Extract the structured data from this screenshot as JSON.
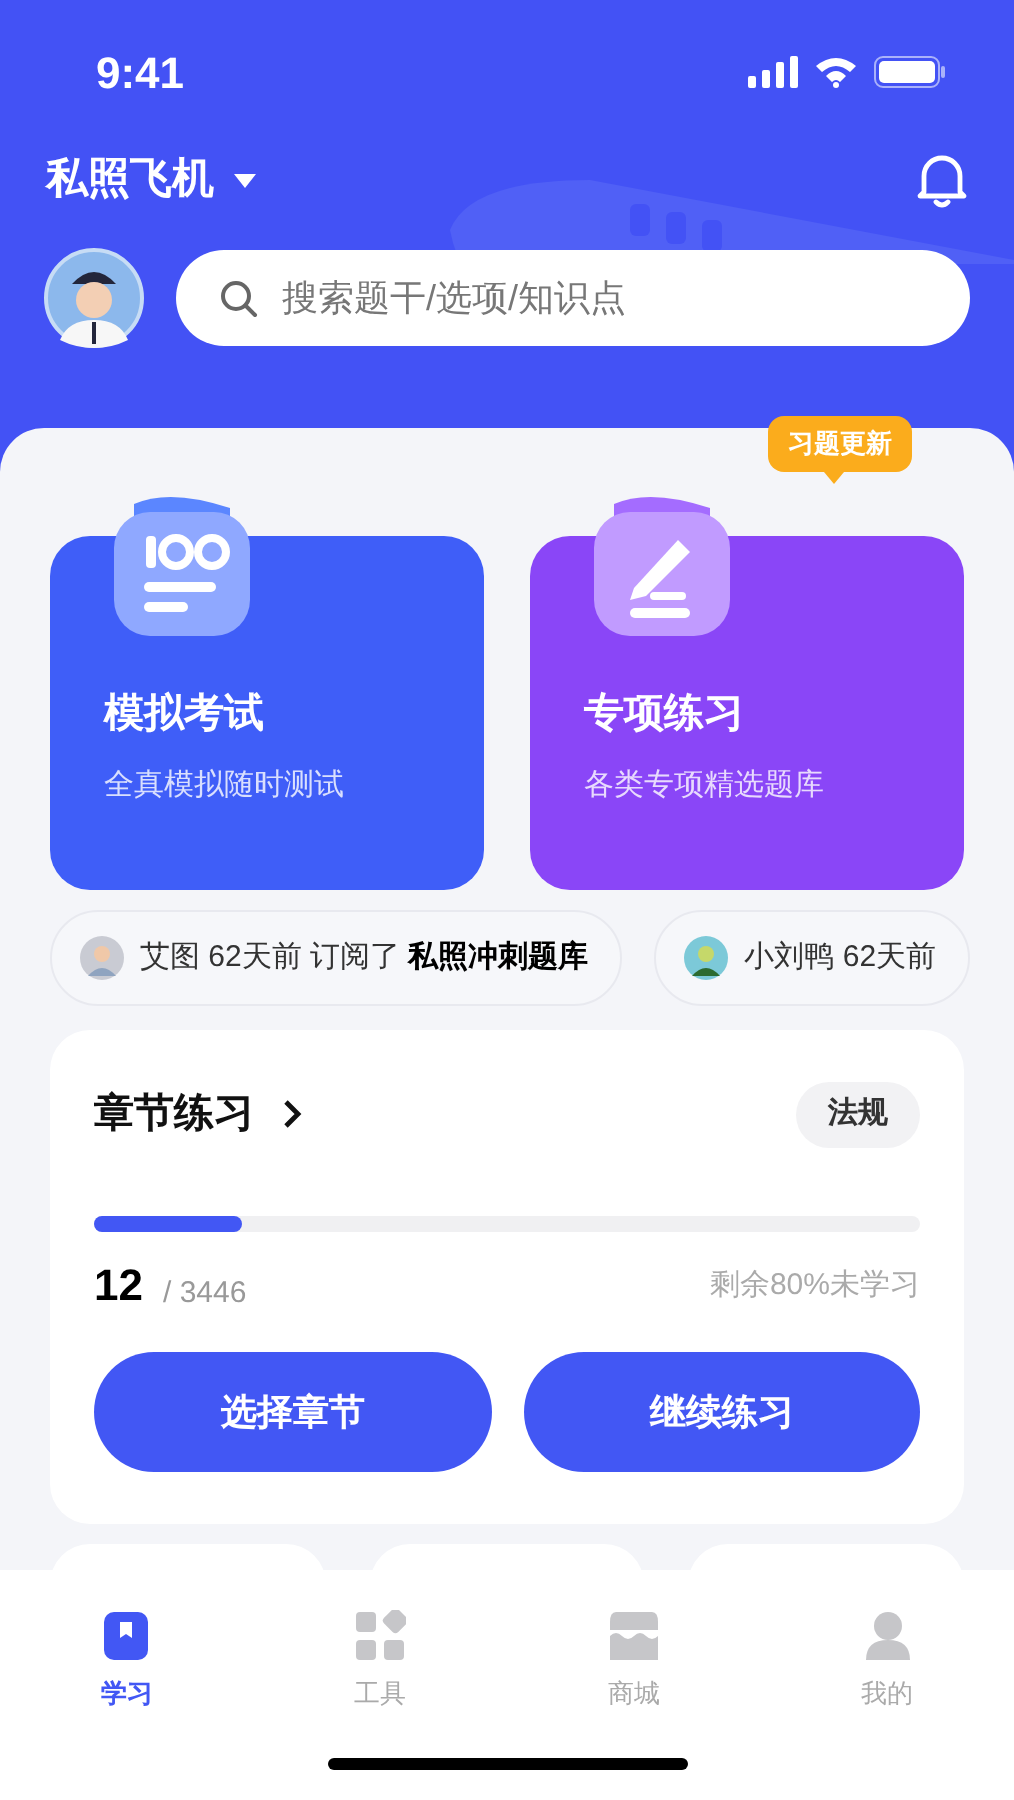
{
  "status_bar": {
    "time": "9:41"
  },
  "header": {
    "subject": "私照飞机"
  },
  "search": {
    "placeholder": "搜索题干/选项/知识点"
  },
  "feature_cards": [
    {
      "kind": "exam",
      "title": "模拟考试",
      "subtitle": "全真模拟随时测试",
      "color": "#3f5ef8"
    },
    {
      "kind": "practice",
      "title": "专项练习",
      "subtitle": "各类专项精选题库",
      "color": "#8a46f7",
      "badge": "习题更新"
    }
  ],
  "ticker": [
    {
      "text": "艾图 62天前 订阅了 **私照冲刺题库**"
    },
    {
      "text": "小刘鸭 62天前"
    }
  ],
  "chapter": {
    "title": "章节练习",
    "tag": "法规",
    "level": 0.18,
    "done": "12",
    "total": "/ 3446",
    "remaining": "剩余80%未学习",
    "buttons": [
      "选择章节",
      "继续练习"
    ]
  },
  "tab_bar": [
    {
      "kind": "study",
      "label": "学习",
      "selected": true
    },
    {
      "kind": "tools",
      "label": "工具",
      "selected": false
    },
    {
      "kind": "shop",
      "label": "商城",
      "selected": false
    },
    {
      "kind": "me",
      "label": "我的",
      "selected": false
    }
  ]
}
